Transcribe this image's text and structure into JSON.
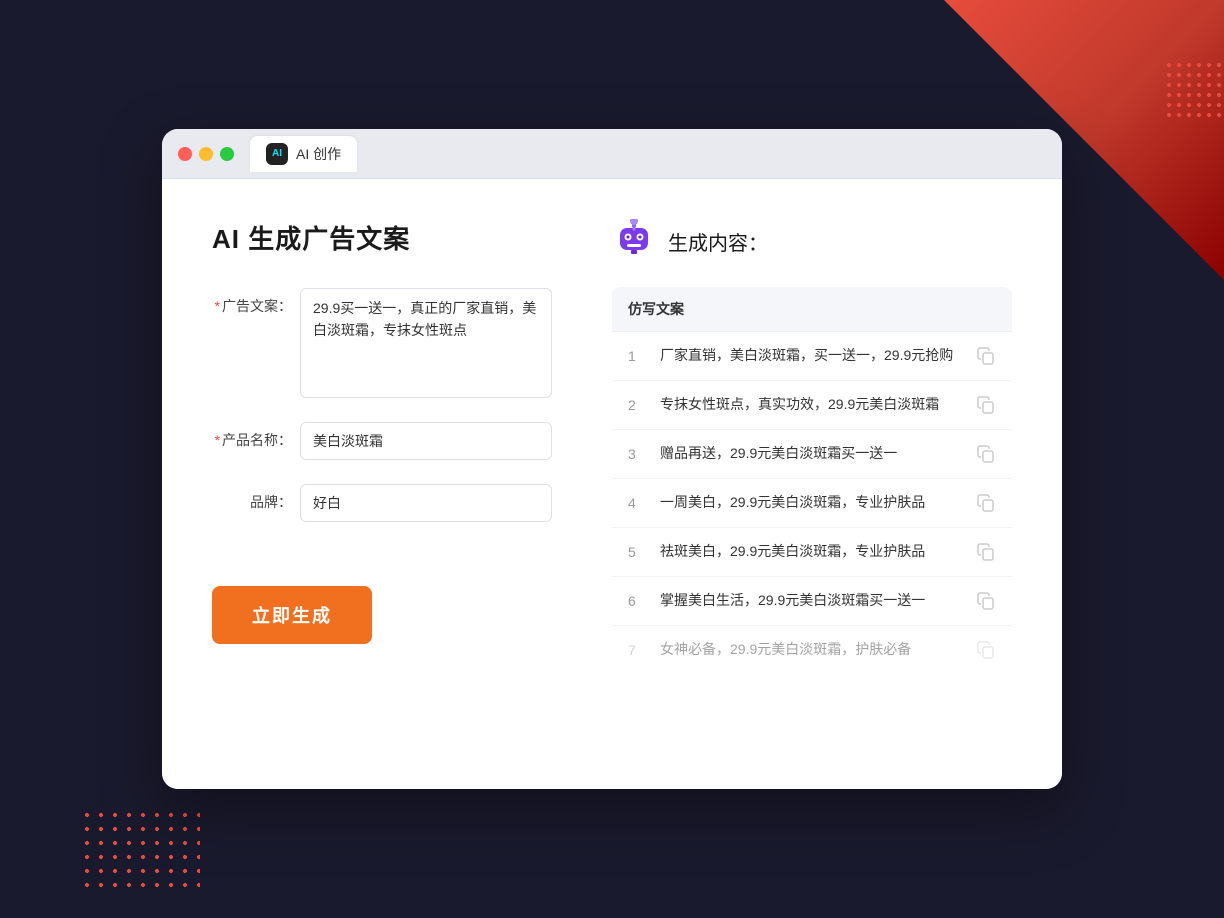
{
  "background": {
    "color": "#1a1a2e"
  },
  "browser": {
    "tab_icon_text": "AI",
    "tab_title": "AI 创作"
  },
  "left_panel": {
    "page_title": "AI 生成广告文案",
    "form": {
      "ad_copy_label": "广告文案：",
      "ad_copy_required": "*",
      "ad_copy_value": "29.9买一送一，真正的厂家直销，美白淡斑霜，专抹女性斑点",
      "product_name_label": "产品名称：",
      "product_name_required": "*",
      "product_name_value": "美白淡斑霜",
      "brand_label": "品牌：",
      "brand_value": "好白"
    },
    "generate_button": "立即生成"
  },
  "right_panel": {
    "robot_icon": "robot",
    "result_title": "生成内容：",
    "results_header": "仿写文案",
    "results": [
      {
        "id": 1,
        "text": "厂家直销，美白淡斑霜，买一送一，29.9元抢购",
        "dimmed": false
      },
      {
        "id": 2,
        "text": "专抹女性斑点，真实功效，29.9元美白淡斑霜",
        "dimmed": false
      },
      {
        "id": 3,
        "text": "赠品再送，29.9元美白淡斑霜买一送一",
        "dimmed": false
      },
      {
        "id": 4,
        "text": "一周美白，29.9元美白淡斑霜，专业护肤品",
        "dimmed": false
      },
      {
        "id": 5,
        "text": "祛斑美白，29.9元美白淡斑霜，专业护肤品",
        "dimmed": false
      },
      {
        "id": 6,
        "text": "掌握美白生活，29.9元美白淡斑霜买一送一",
        "dimmed": false
      },
      {
        "id": 7,
        "text": "女神必备，29.9元美白淡斑霜，护肤必备",
        "dimmed": true
      }
    ]
  }
}
